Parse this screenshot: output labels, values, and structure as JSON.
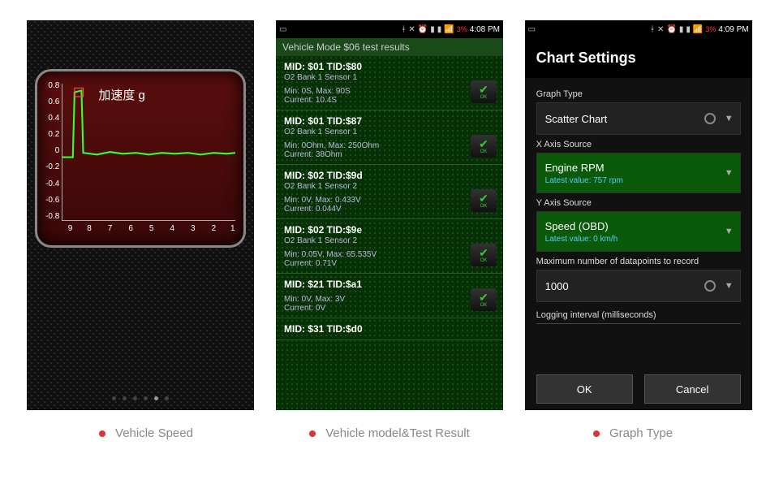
{
  "statusbar": {
    "battery": "3%",
    "time1": "4:08 PM",
    "time2": "4:09 PM"
  },
  "phone1": {
    "gauge_title": "加速度 g",
    "yticks": [
      "0.8",
      "0.6",
      "0.4",
      "0.2",
      "0",
      "-0.2",
      "-0.4",
      "-0.6",
      "-0.8"
    ],
    "xticks": [
      "9",
      "8",
      "7",
      "6",
      "5",
      "4",
      "3",
      "2",
      "1"
    ]
  },
  "phone2": {
    "header": "Vehicle Mode $06 test results",
    "items": [
      {
        "mid": "MID: $01 TID:$80",
        "sub": "O2 Bank 1 Sensor 1",
        "vals": "Min: 0S, Max: 90S\nCurrent: 10.4S",
        "ok": true
      },
      {
        "mid": "MID: $01 TID:$87",
        "sub": "O2 Bank 1 Sensor 1",
        "vals": "Min: 0Ohm, Max: 250Ohm\nCurrent: 38Ohm",
        "ok": true
      },
      {
        "mid": "MID: $02 TID:$9d",
        "sub": "O2 Bank 1 Sensor 2",
        "vals": "Min: 0V, Max: 0.433V\nCurrent: 0.044V",
        "ok": true
      },
      {
        "mid": "MID: $02 TID:$9e",
        "sub": "O2 Bank 1 Sensor 2",
        "vals": "Min: 0.05V, Max: 65.535V\nCurrent: 0.71V",
        "ok": true
      },
      {
        "mid": "MID: $21 TID:$a1",
        "sub": "",
        "vals": "Min: 0V, Max: 3V\nCurrent: 0V",
        "ok": true
      },
      {
        "mid": "MID: $31 TID:$d0",
        "sub": "",
        "vals": "",
        "ok": false
      }
    ],
    "ok_label": "OK"
  },
  "phone3": {
    "title": "Chart Settings",
    "graph_type_label": "Graph Type",
    "graph_type_value": "Scatter Chart",
    "x_label": "X Axis Source",
    "x_value": "Engine RPM",
    "x_latest": "Latest value: 757 rpm",
    "y_label": "Y Axis Source",
    "y_value": "Speed (OBD)",
    "y_latest": "Latest value: 0 km/h",
    "max_label": "Maximum number of datapoints to record",
    "max_value": "1000",
    "interval_label": "Logging interval (milliseconds)",
    "ok_btn": "OK",
    "cancel_btn": "Cancel"
  },
  "captions": {
    "c1": "Vehicle Speed",
    "c2": "Vehicle model&Test Result",
    "c3": "Graph Type"
  },
  "chart_data": {
    "type": "line",
    "title": "加速度 g",
    "xlabel": "",
    "ylabel": "",
    "x": [
      9,
      8.8,
      8.6,
      8.5,
      8,
      7.5,
      7,
      6.5,
      6,
      5.5,
      5,
      4.5,
      4,
      3.5,
      3,
      2.5,
      2,
      1.5,
      1
    ],
    "values": [
      0,
      0,
      0.85,
      0.9,
      0.05,
      0.04,
      0.06,
      0.03,
      0.05,
      0.04,
      0.03,
      0.05,
      0.04,
      0.03,
      0.05,
      0.04,
      0.03,
      0.05,
      0.04
    ],
    "ylim": [
      -0.9,
      0.9
    ]
  }
}
